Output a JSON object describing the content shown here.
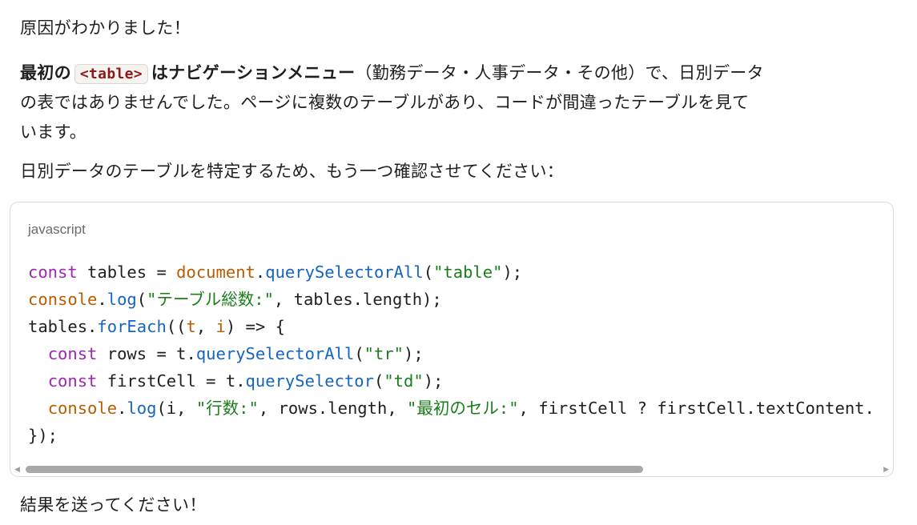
{
  "message": {
    "p1": "原因がわかりました！",
    "p2": {
      "bold_pre": "最初の",
      "inline_code": "<table>",
      "bold_post": "はナビゲーションメニュー",
      "line1_rest": "（勤務データ・人事データ・その他）で、日別データ",
      "line2": "の表ではありませんでした。ページに複数のテーブルがあり、コードが間違ったテーブルを見て",
      "line3": "います。"
    },
    "p3": "日別データのテーブルを特定するため、もう一つ確認させてください：",
    "p4": "結果を送ってください！"
  },
  "code_block": {
    "language": "javascript",
    "line1": {
      "k": "const",
      "a": " tables = ",
      "o": "document",
      "b": ".",
      "f": "querySelectorAll",
      "c": "(",
      "s": "\"table\"",
      "d": ");"
    },
    "line2": {
      "o": "console",
      "a": ".",
      "f": "log",
      "b": "(",
      "s": "\"テーブル総数:\"",
      "c": ", tables.length);"
    },
    "line3": {
      "a": "tables.",
      "f": "forEach",
      "b": "((",
      "p1": "t",
      "c": ", ",
      "p2": "i",
      "d": ") => {"
    },
    "line4": {
      "i": "  ",
      "k": "const",
      "a": " rows = t.",
      "f": "querySelectorAll",
      "b": "(",
      "s": "\"tr\"",
      "c": ");"
    },
    "line5": {
      "i": "  ",
      "k": "const",
      "a": " firstCell = t.",
      "f": "querySelector",
      "b": "(",
      "s": "\"td\"",
      "c": ");"
    },
    "line6": {
      "i": "  ",
      "o": "console",
      "a": ".",
      "f": "log",
      "b": "(i, ",
      "s1": "\"行数:\"",
      "c": ", rows.length, ",
      "s2": "\"最初のセル:\"",
      "d": ", firstCell ? firstCell.textContent."
    },
    "line7": "});",
    "horizontal_scroll": 0.0
  }
}
